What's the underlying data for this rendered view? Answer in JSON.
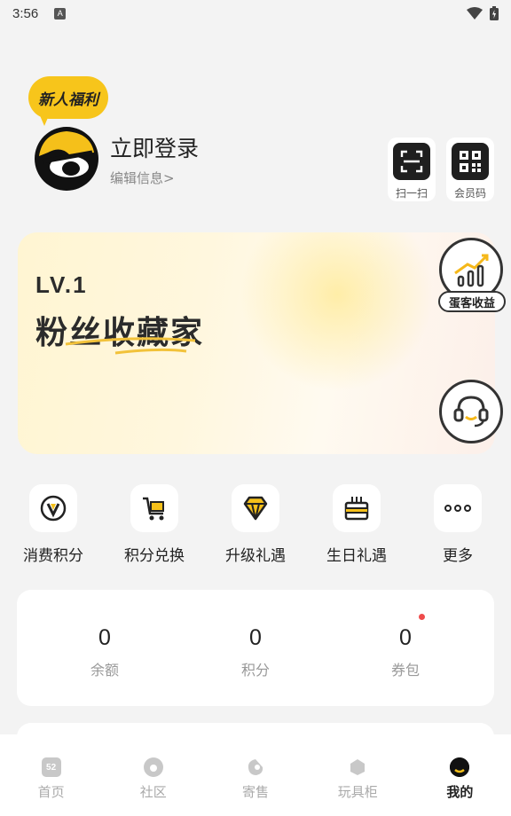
{
  "status": {
    "time": "3:56",
    "notification": "A"
  },
  "profile": {
    "badge": "新人福利",
    "title": "立即登录",
    "edit": "编辑信息>"
  },
  "quick_actions": [
    {
      "label": "扫一扫",
      "icon": "scan-icon"
    },
    {
      "label": "会员码",
      "icon": "qr-code-icon"
    }
  ],
  "level": {
    "level": "LV.1",
    "name": "粉丝收藏家"
  },
  "floating": {
    "earnings_label": "蛋客收益",
    "earnings_icon": "bar-chart-icon",
    "support_icon": "headset-icon"
  },
  "functions": [
    {
      "label": "消费积分",
      "icon": "v-points-icon"
    },
    {
      "label": "积分兑换",
      "icon": "cart-icon"
    },
    {
      "label": "升级礼遇",
      "icon": "diamond-icon"
    },
    {
      "label": "生日礼遇",
      "icon": "cake-icon"
    },
    {
      "label": "更多",
      "icon": "more-icon"
    }
  ],
  "stats": [
    {
      "value": "0",
      "label": "余额"
    },
    {
      "value": "0",
      "label": "积分"
    },
    {
      "value": "0",
      "label": "券包"
    }
  ],
  "tabs": [
    {
      "label": "首页",
      "icon": "home-icon"
    },
    {
      "label": "社区",
      "icon": "community-icon"
    },
    {
      "label": "寄售",
      "icon": "consign-icon"
    },
    {
      "label": "玩具柜",
      "icon": "cabinet-icon"
    },
    {
      "label": "我的",
      "icon": "profile-icon"
    }
  ],
  "colors": {
    "accent": "#f7c51b",
    "dot": "#ef4b4b",
    "background": "#f3f3f3"
  }
}
